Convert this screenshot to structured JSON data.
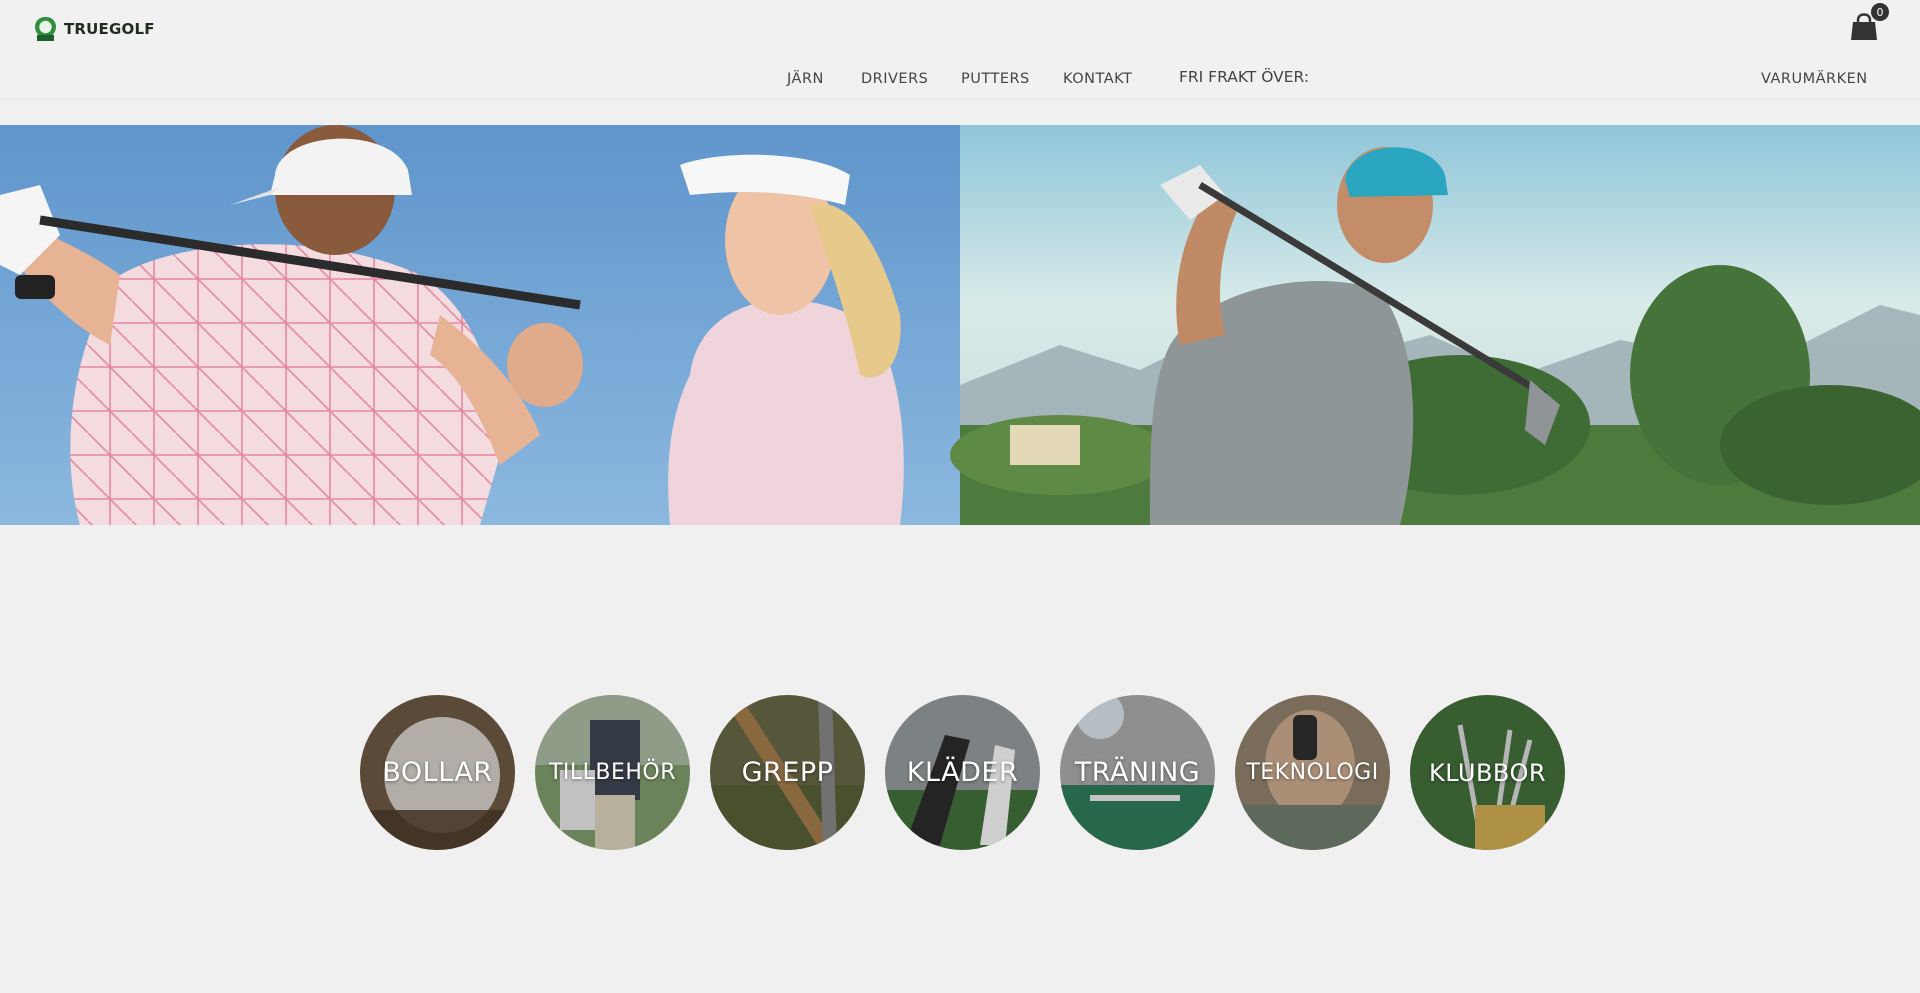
{
  "brand": {
    "name": "TRUEGOLF",
    "accent": "#2f8f3e"
  },
  "cart": {
    "count": "0",
    "icon": "shopping-bag-icon"
  },
  "nav": {
    "items": [
      {
        "label": "JÄRN"
      },
      {
        "label": "DRIVERS"
      },
      {
        "label": "PUTTERS"
      },
      {
        "label": "KONTAKT"
      }
    ],
    "promo": "FRI FRAKT ÖVER:",
    "brands": "VARUMÄRKEN"
  },
  "categories": [
    {
      "label": "BOLLAR"
    },
    {
      "label": "TILLBEHÖR"
    },
    {
      "label": "GREPP"
    },
    {
      "label": "KLÄDER"
    },
    {
      "label": "TRÄNING"
    },
    {
      "label": "TEKNOLOGI"
    },
    {
      "label": "KLUBBOR"
    }
  ]
}
